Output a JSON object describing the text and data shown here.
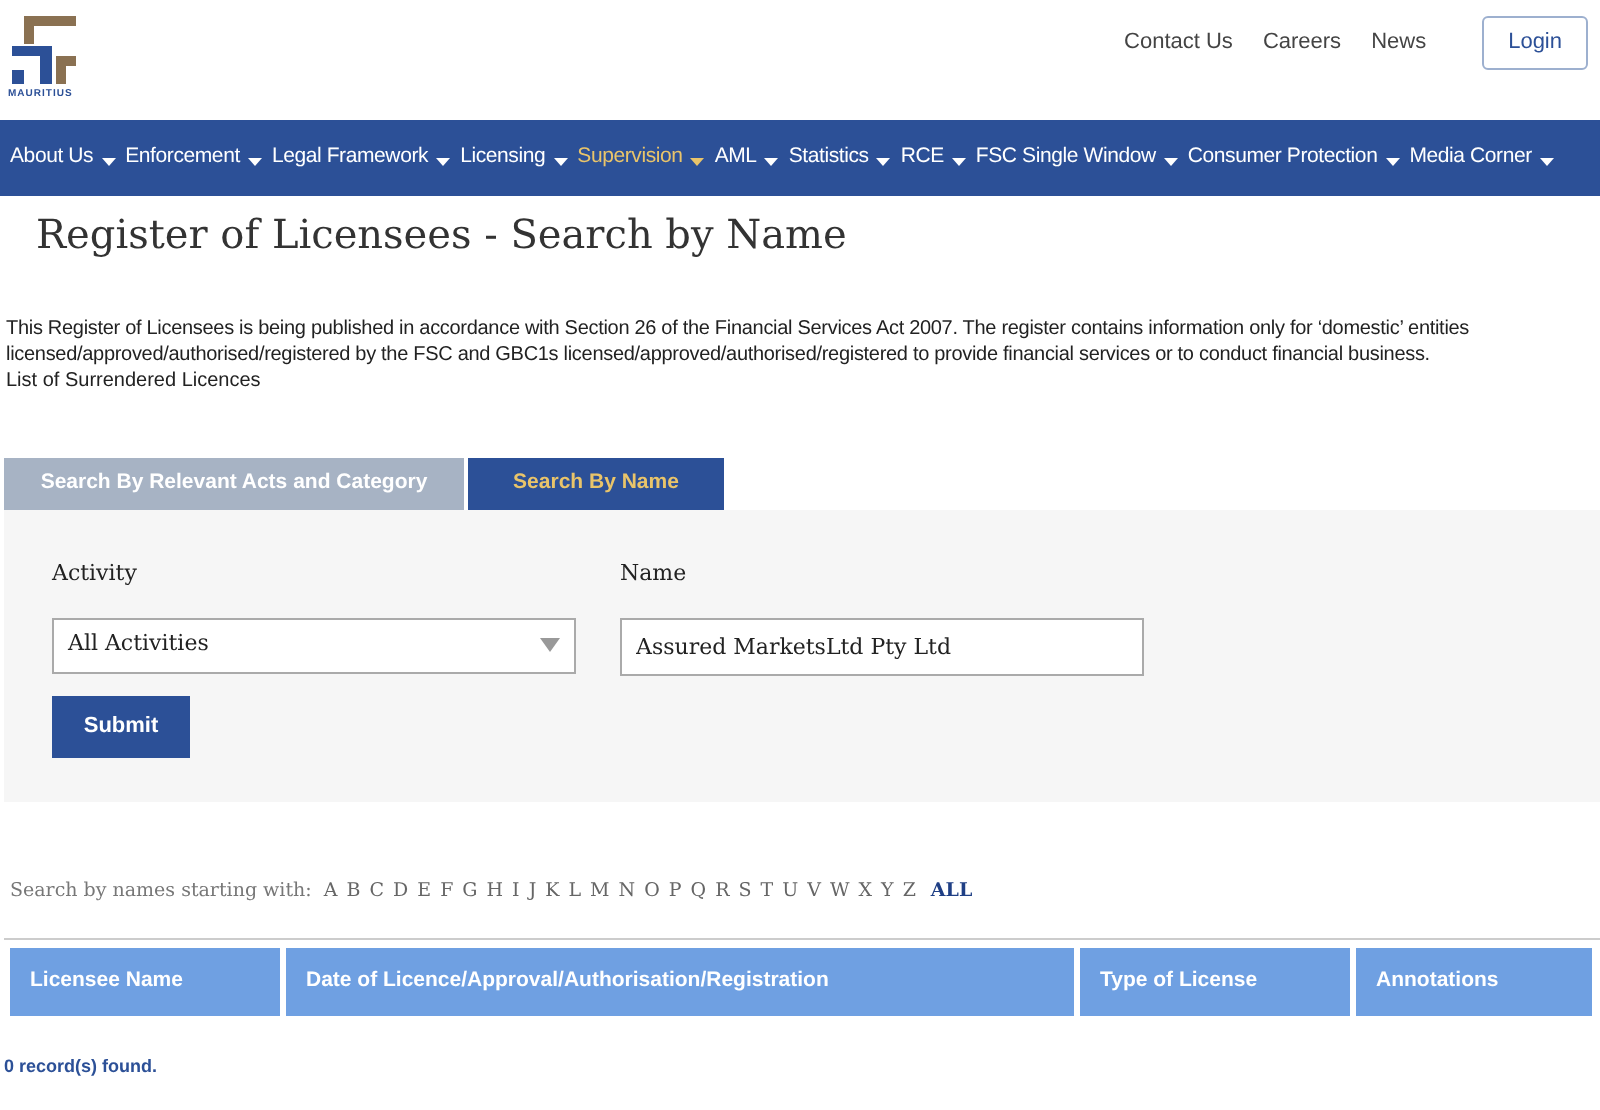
{
  "logo": {
    "caption": "MAURITIUS"
  },
  "top_links": [
    "Contact Us",
    "Careers",
    "News"
  ],
  "login_button": "Login",
  "nav": [
    {
      "label": "About Us",
      "selected": false
    },
    {
      "label": "Enforcement",
      "selected": false
    },
    {
      "label": "Legal Framework",
      "selected": false
    },
    {
      "label": "Licensing",
      "selected": false
    },
    {
      "label": "Supervision",
      "selected": true
    },
    {
      "label": "AML",
      "selected": false
    },
    {
      "label": "Statistics",
      "selected": false
    },
    {
      "label": "RCE",
      "selected": false
    },
    {
      "label": "FSC Single Window",
      "selected": false
    },
    {
      "label": "Consumer Protection",
      "selected": false
    },
    {
      "label": "Media Corner",
      "selected": false
    }
  ],
  "page_title": "Register of Licensees - Search by Name",
  "intro": "This Register of Licensees is being published in accordance with Section 26 of the Financial Services Act 2007. The register contains information only for ‘domestic’ entities licensed/approved/authorised/registered by the FSC and GBC1s licensed/approved/authorised/registered to provide financial services or to conduct financial business.",
  "surrendered_link": "List of Surrendered Licences",
  "tabs": [
    {
      "label": "Search By Relevant Acts and Category",
      "selected": false
    },
    {
      "label": "Search By Name",
      "selected": true
    }
  ],
  "form": {
    "activity_label": "Activity",
    "activity_value": "All Activities",
    "name_label": "Name",
    "name_value": "Assured MarketsLtd Pty Ltd",
    "submit": "Submit"
  },
  "alphabet": {
    "label": "Search by names starting with:",
    "letters": [
      {
        "label": "A",
        "selected": false
      },
      {
        "label": "B",
        "selected": false
      },
      {
        "label": "C",
        "selected": false
      },
      {
        "label": "D",
        "selected": false
      },
      {
        "label": "E",
        "selected": false
      },
      {
        "label": "F",
        "selected": false
      },
      {
        "label": "G",
        "selected": false
      },
      {
        "label": "H",
        "selected": false
      },
      {
        "label": "I",
        "selected": false
      },
      {
        "label": "J",
        "selected": false
      },
      {
        "label": "K",
        "selected": false
      },
      {
        "label": "L",
        "selected": false
      },
      {
        "label": "M",
        "selected": false
      },
      {
        "label": "N",
        "selected": false
      },
      {
        "label": "O",
        "selected": false
      },
      {
        "label": "P",
        "selected": false
      },
      {
        "label": "Q",
        "selected": false
      },
      {
        "label": "R",
        "selected": false
      },
      {
        "label": "S",
        "selected": false
      },
      {
        "label": "T",
        "selected": false
      },
      {
        "label": "U",
        "selected": false
      },
      {
        "label": "V",
        "selected": false
      },
      {
        "label": "W",
        "selected": false
      },
      {
        "label": "X",
        "selected": false
      },
      {
        "label": "Y",
        "selected": false
      },
      {
        "label": "Z",
        "selected": false
      },
      {
        "label": "ALL",
        "selected": true
      }
    ]
  },
  "table": {
    "columns": [
      "Licensee Name",
      "Date of Licence/Approval/Authorisation/Registration",
      "Type of License",
      "Annotations"
    ]
  },
  "result_count": "0 record(s) found."
}
